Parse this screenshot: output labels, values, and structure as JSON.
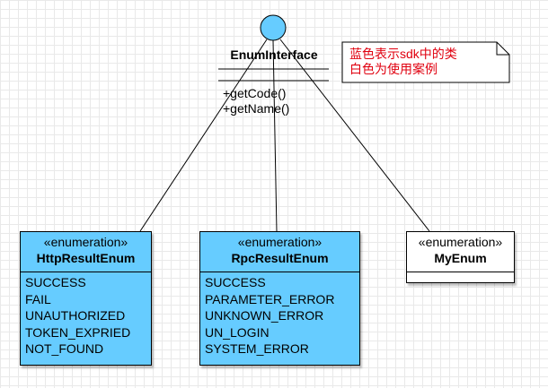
{
  "interface": {
    "name": "EnumInterface",
    "methods": [
      "+getCode()",
      "+getName()"
    ]
  },
  "note": {
    "lines": [
      "蓝色表示sdk中的类",
      "白色为使用案例"
    ]
  },
  "classes": [
    {
      "stereotype": "«enumeration»",
      "name": "HttpResultEnum",
      "literals": [
        "SUCCESS",
        "FAIL",
        "UNAUTHORIZED",
        "TOKEN_EXPRIED",
        "NOT_FOUND"
      ]
    },
    {
      "stereotype": "«enumeration»",
      "name": "RpcResultEnum",
      "literals": [
        "SUCCESS",
        "PARAMETER_ERROR",
        "UNKNOWN_ERROR",
        "UN_LOGIN",
        "SYSTEM_ERROR"
      ]
    },
    {
      "stereotype": "«enumeration»",
      "name": "MyEnum",
      "literals": []
    }
  ],
  "colors": {
    "sdk_class_fill": "#66ccff",
    "example_class_fill": "#ffffff",
    "note_text": "#e0000f"
  }
}
